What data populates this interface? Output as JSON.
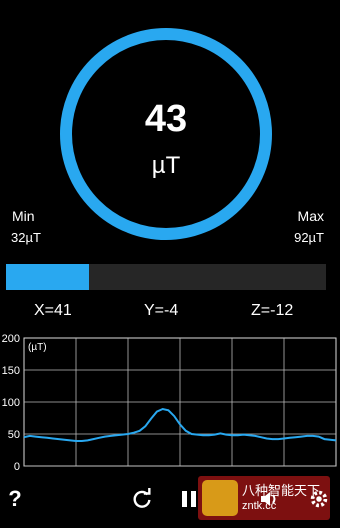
{
  "reading": {
    "value": "43",
    "unit": "µT"
  },
  "min": {
    "label": "Min",
    "value": "32µT"
  },
  "max": {
    "label": "Max",
    "value": "92µT"
  },
  "strength_fraction": 0.26,
  "axes": {
    "x": "X=41",
    "y": "Y=-4",
    "z": "Z=-12"
  },
  "colors": {
    "accent": "#29A8F0",
    "background": "#000000",
    "bar_track": "#262626"
  },
  "chart_data": {
    "type": "line",
    "ylabel": "(µT)",
    "ylim": [
      0,
      200
    ],
    "yticks": [
      "200",
      "150",
      "100",
      "50",
      "0"
    ],
    "grid": true,
    "series": [
      {
        "values": [
          45,
          47,
          46,
          45,
          44,
          43,
          42,
          41,
          40,
          39,
          39,
          40,
          42,
          44,
          46,
          47,
          48,
          49,
          50,
          52,
          55,
          62,
          74,
          85,
          89,
          87,
          78,
          65,
          55,
          50,
          49,
          48,
          48,
          49,
          51,
          49,
          48,
          48,
          49,
          48,
          47,
          45,
          43,
          42,
          42,
          43,
          44,
          45,
          46,
          47,
          47,
          46,
          42,
          41,
          40
        ]
      }
    ]
  },
  "icons": {
    "help": "help-icon",
    "refresh": "refresh-icon",
    "pause": "pause-icon",
    "sound": "speaker-icon",
    "settings": "gear-icon"
  },
  "watermark": {
    "line1": "八种智能天下",
    "line2": "zntk.cc"
  }
}
